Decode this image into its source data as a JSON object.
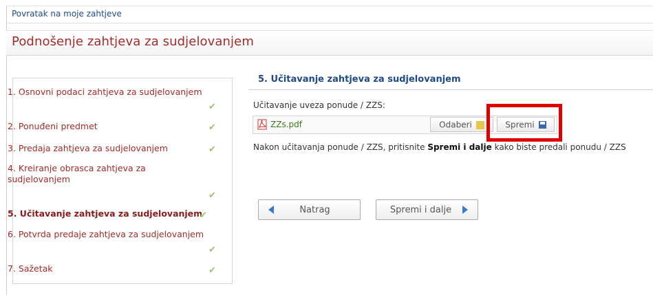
{
  "header": {
    "back_link": "Povratak na moje zahtjeve",
    "title": "Podnošenje zahtjeva za sudjelovanjem"
  },
  "steps": [
    {
      "label": "1. Osnovni podaci zahtjeva za sudjelovanjem",
      "done": true,
      "current": false
    },
    {
      "label": "2. Ponuđeni predmet",
      "done": true,
      "current": false
    },
    {
      "label": "3. Predaja zahtjeva za sudjelovanjem",
      "done": true,
      "current": false
    },
    {
      "label_line1": "4. Kreiranje obrasca zahtjeva za",
      "label_line2": "sudjelovanjem",
      "done": true,
      "current": false
    },
    {
      "label": "5. Učitavanje zahtjeva za sudjelovanjem",
      "done": true,
      "current": true
    },
    {
      "label": "6. Potvrda predaje zahtjeva za sudjelovanjem",
      "done": true,
      "current": false
    },
    {
      "label": "7. Sažetak",
      "done": true,
      "current": false
    }
  ],
  "main": {
    "section_title": "5. Učitavanje zahtjeva za sudjelovanjem",
    "upload_label": "Učitavanje uveza ponude / ZZS:",
    "file_name": "ZZs.pdf",
    "browse_label": "Odaberi",
    "save_label": "Spremi",
    "instruction_pre": "Nakon učitavanja ponude / ZZS, pritisnite ",
    "instruction_bold": "Spremi i dalje",
    "instruction_post": " kako biste predali ponudu / ZZS",
    "back_button": "Natrag",
    "next_button": "Spremi i dalje"
  },
  "colors": {
    "accent_title": "#a52a2a",
    "link_blue": "#1f4a8a",
    "highlight_red": "#e00000",
    "check_green": "#9bc26b"
  },
  "icons": [
    "pdf-icon",
    "folder-icon",
    "save-icon",
    "check-icon",
    "arrow-left-icon",
    "arrow-right-icon"
  ]
}
